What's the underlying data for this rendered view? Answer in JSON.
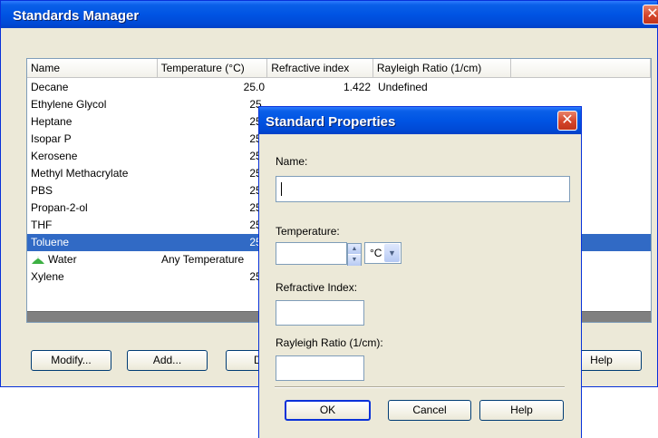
{
  "main_window": {
    "title": "Standards Manager",
    "close_glyph": "✕",
    "columns": [
      "Name",
      "Temperature (°C)",
      "Refractive index",
      "Rayleigh Ratio (1/cm)",
      ""
    ],
    "rows": [
      {
        "name": "Decane",
        "temperature": "25.0",
        "refractive_index": "1.422",
        "rayleigh": "Undefined"
      },
      {
        "name": "Ethylene Glycol",
        "temperature": "25.",
        "refractive_index": "",
        "rayleigh": ""
      },
      {
        "name": "Heptane",
        "temperature": "25.",
        "refractive_index": "",
        "rayleigh": ""
      },
      {
        "name": "Isopar P",
        "temperature": "25.",
        "refractive_index": "",
        "rayleigh": ""
      },
      {
        "name": "Kerosene",
        "temperature": "25.",
        "refractive_index": "",
        "rayleigh": ""
      },
      {
        "name": "Methyl Methacrylate",
        "temperature": "25.",
        "refractive_index": "",
        "rayleigh": ""
      },
      {
        "name": "PBS",
        "temperature": "25.",
        "refractive_index": "",
        "rayleigh": ""
      },
      {
        "name": "Propan-2-ol",
        "temperature": "25.",
        "refractive_index": "",
        "rayleigh": ""
      },
      {
        "name": "THF",
        "temperature": "25.",
        "refractive_index": "",
        "rayleigh": ""
      },
      {
        "name": "Toluene",
        "temperature": "25.",
        "refractive_index": "",
        "rayleigh": ""
      },
      {
        "name": "Water",
        "temperature": "Any Temperature",
        "refractive_index": "",
        "rayleigh": ""
      },
      {
        "name": "Xylene",
        "temperature": "25.",
        "refractive_index": "",
        "rayleigh": ""
      }
    ],
    "selected_row": "Toluene",
    "buttons": {
      "modify": "Modify...",
      "add": "Add...",
      "partial": "D",
      "help": "Help"
    }
  },
  "dialog": {
    "title": "Standard Properties",
    "close_glyph": "✕",
    "name_label": "Name:",
    "name_value": "",
    "temperature_label": "Temperature:",
    "temperature_value": "",
    "spin_up": "▲",
    "spin_down": "▼",
    "unit_value": "°C",
    "unit_arrow": "▼",
    "refractive_label": "Refractive Index:",
    "refractive_value": "",
    "rayleigh_label": "Rayleigh Ratio (1/cm):",
    "rayleigh_value": "",
    "buttons": {
      "ok": "OK",
      "cancel": "Cancel",
      "help": "Help"
    }
  },
  "colors": {
    "titlebar": "#0054e3",
    "selection": "#316ac5",
    "close": "#d4452a",
    "window_face": "#ece9d8",
    "water_icon": "#3cb043"
  }
}
